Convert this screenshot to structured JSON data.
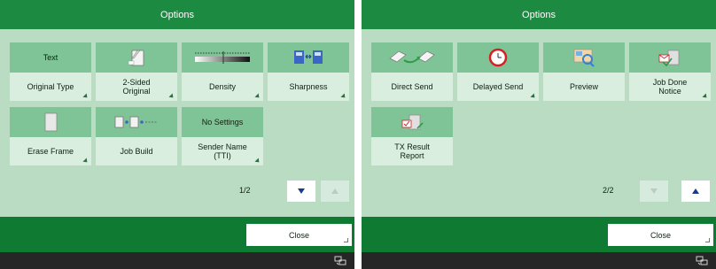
{
  "colors": {
    "title_bar": "#1c8a40",
    "panel_bg": "#b9dcc3",
    "tile_top": "#7fc496",
    "tile_bottom": "#d9eedf",
    "footer": "#0f7a31",
    "status_bar": "#262626",
    "arrow_blue": "#1a3a8f"
  },
  "left": {
    "title": "Options",
    "tiles": [
      {
        "top_text": "Text",
        "label": "Original Type",
        "icon": ""
      },
      {
        "top_text": "",
        "label": "2-Sided\nOriginal",
        "icon": "two-sided-document-icon"
      },
      {
        "top_text": "",
        "label": "Density",
        "icon": "density-slider-icon"
      },
      {
        "top_text": "",
        "label": "Sharpness",
        "icon": "sharpness-compare-icon"
      },
      {
        "top_text": "",
        "label": "Erase Frame",
        "icon": "erase-frame-page-icon"
      },
      {
        "top_text": "",
        "label": "Job Build",
        "icon": "job-build-icon"
      },
      {
        "top_text": "No Settings",
        "label": "Sender Name\n(TTI)",
        "icon": ""
      }
    ],
    "page": "1/2",
    "close_label": "Close"
  },
  "right": {
    "title": "Options",
    "tiles": [
      {
        "label": "Direct Send",
        "icon": "direct-send-icon"
      },
      {
        "label": "Delayed Send",
        "icon": "delayed-send-clock-icon"
      },
      {
        "label": "Preview",
        "icon": "preview-magnifier-icon"
      },
      {
        "label": "Job Done\nNotice",
        "icon": "job-done-notice-icon"
      },
      {
        "label": "TX Result\nReport",
        "icon": "tx-result-report-icon"
      }
    ],
    "page": "2/2",
    "close_label": "Close"
  }
}
